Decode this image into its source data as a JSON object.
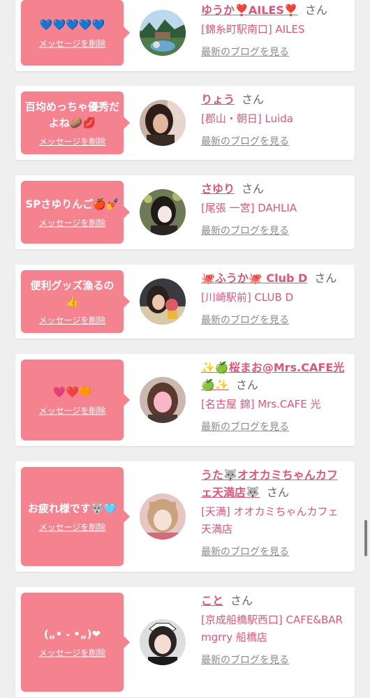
{
  "labels": {
    "delete": "メッセージを削除",
    "blog": "最新のブログを見る",
    "suffix": "さん"
  },
  "cards": [
    {
      "bubble": "💙💙💙💙💙",
      "name": "ゆうか❣️AILES❣️",
      "shop": "[錦糸町駅南口] AILES",
      "avatar_icon": "avatar-landscape-photo"
    },
    {
      "bubble": "百均めっちゃ優秀だよね🥔💋",
      "name": "りょう",
      "shop": "[郡山・朝日] Luida",
      "avatar_icon": "avatar-woman-photo"
    },
    {
      "bubble": "SPさゆりんご🍎💅",
      "name": "さゆり",
      "shop": "[尾張 一宮] DAHLIA",
      "avatar_icon": "avatar-woman-photo"
    },
    {
      "bubble": "便利グッズ漁るの👍",
      "name": "🐙ふうか🐙 Club D",
      "shop": "[川崎駅前] CLUB D",
      "avatar_icon": "avatar-woman-photo"
    },
    {
      "bubble": "💗❤️🧡",
      "name": "✨🍏桜まお@Mrs.CAFE光🍏✨",
      "shop": "[名古屋 錦] Mrs.CAFE 光",
      "avatar_icon": "avatar-woman-photo"
    },
    {
      "bubble": "お疲れ様です🐺🩵",
      "name": "うた🐺オオカミちゃんカフェ天満店🐺",
      "shop": "[天満] オオカミちゃんカフェ天満店",
      "avatar_icon": "avatar-woman-photo"
    },
    {
      "bubble": "(„• ֊ •„)❤",
      "name": "こと",
      "shop": "[京成船橋駅西口] CAFE&BAR mgrry 船橋店",
      "avatar_icon": "avatar-woman-photo"
    }
  ],
  "colors": {
    "bubble": "#f4838f",
    "name": "#e0557a",
    "blog_link": "#8a8a8a",
    "background": "#efefef"
  }
}
